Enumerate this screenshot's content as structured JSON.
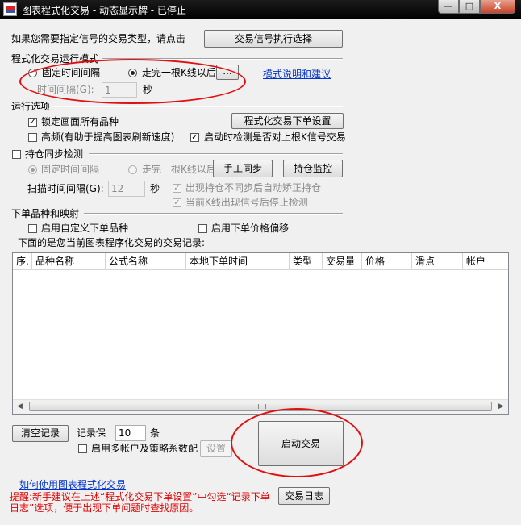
{
  "window": {
    "title": "图表程式化交易 - 动态显示牌 - 已停止",
    "min_glyph": "—",
    "max_glyph": "□",
    "close_glyph": "X"
  },
  "top": {
    "prompt": "如果您需要指定信号的交易类型，请点击",
    "signal_button": "交易信号执行选择"
  },
  "mode": {
    "section_title": "程式化交易运行模式",
    "fixed_interval_label": "固定时间间隔",
    "fixed_interval_selected": false,
    "after_bar_label": "走完一根K线以后",
    "after_bar_selected": true,
    "after_bar_button": "...",
    "help_link": "模式说明和建议",
    "interval_label": "时间间隔(G):",
    "interval_value": "1",
    "interval_unit": "秒"
  },
  "options": {
    "section_title": "运行选项",
    "lock_label": "锁定画面所有品种",
    "lock_checked": true,
    "order_settings_button": "程式化交易下单设置",
    "high_freq_label": "高频(有助于提高图表刷新速度)",
    "high_freq_checked": false,
    "startup_check_label": "启动时检测是否对上根K信号交易",
    "startup_check_checked": true
  },
  "sync": {
    "section_label": "持仓同步检测",
    "section_checked": false,
    "fixed_interval_label": "固定时间间隔",
    "after_bar_label": "走完一根K线以后",
    "manual_sync_button": "手工同步",
    "monitor_button": "持仓监控",
    "scan_interval_label": "扫描时间间隔(G):",
    "scan_interval_value": "12",
    "scan_interval_unit": "秒",
    "auto_fix_label": "出现持仓不同步后自动矫正持仓",
    "auto_fix_checked": true,
    "stop_check_label": "当前K线出现信号后停止检测",
    "stop_check_checked": true
  },
  "mapping": {
    "section_title": "下单品种和映射",
    "custom_symbol_label": "启用自定义下单品种",
    "custom_symbol_checked": false,
    "price_offset_label": "启用下单价格偏移",
    "price_offset_checked": false
  },
  "records": {
    "caption": "下面的是您当前图表程序化交易的交易记录:",
    "columns": [
      "序.",
      "品种名称",
      "公式名称",
      "本地下单时间",
      "类型",
      "交易量",
      "价格",
      "滑点",
      "帐户"
    ],
    "rows": [],
    "scroll_left": "◀",
    "scroll_right": "▶"
  },
  "bottom": {
    "clear_button": "清空记录",
    "keep_label": "记录保",
    "keep_value": "10",
    "keep_unit": "条",
    "multi_account_label": "启用多帐户及策略系数配",
    "multi_account_checked": false,
    "settings_button": "设置",
    "start_button": "启动交易",
    "howto_link": "如何使用图表程式化交易",
    "tip": "提醒:新手建议在上述“程式化交易下单设置”中勾选“记录下单日志”选项，便于出现下单问题时查找原因。",
    "log_button": "交易日志"
  },
  "annotation_color": "#e01010"
}
